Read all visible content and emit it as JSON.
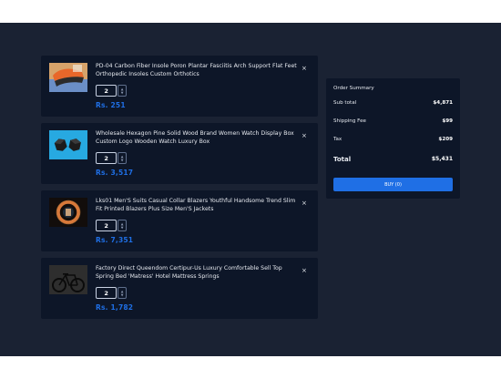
{
  "cart": {
    "items": [
      {
        "title": "PD-04 Carbon Fiber Insole Poron Plantar Fasciitis Arch Support Flat Feet Orthopedic Insoles Custom Orthotics",
        "quantity": "2",
        "price": "Rs. 251",
        "image_icon": "insole-product-image",
        "close": "×"
      },
      {
        "title": "Wholesale Hexagon Pine Solid Wood Brand Women Watch Display Box Custom Logo Wooden Watch Luxury Box",
        "quantity": "2",
        "price": "Rs. 3,517",
        "image_icon": "watch-box-product-image",
        "close": "×"
      },
      {
        "title": "Lks01 Men'S Suits Casual Collar Blazers Youthful Handsome Trend Slim Fit Printed Blazers Plus Size Men'S Jackets",
        "quantity": "2",
        "price": "Rs. 7,351",
        "image_icon": "blazer-product-image",
        "close": "×"
      },
      {
        "title": "Factory Direct Queendom Certipur-Us Luxury Comfortable Sell Top Spring Bed 'Matress' Hotel Mattress Springs",
        "quantity": "2",
        "price": "Rs. 1,782",
        "image_icon": "mattress-product-image",
        "close": "×"
      }
    ],
    "spin_up": "▲",
    "spin_down": "▼"
  },
  "summary": {
    "heading": "Order Summary",
    "subtotal_label": "Sub total",
    "subtotal_value": "$4,871",
    "shipping_label": "Shipping Fee",
    "shipping_value": "$99",
    "tax_label": "Tax",
    "tax_value": "$209",
    "total_label": "Total",
    "total_value": "$5,431",
    "buy_label": "BUY (0)"
  },
  "colors": {
    "background": "#1a2233",
    "card": "#0d1628",
    "accent": "#1f6fe5",
    "text": "#e6e9ef"
  }
}
